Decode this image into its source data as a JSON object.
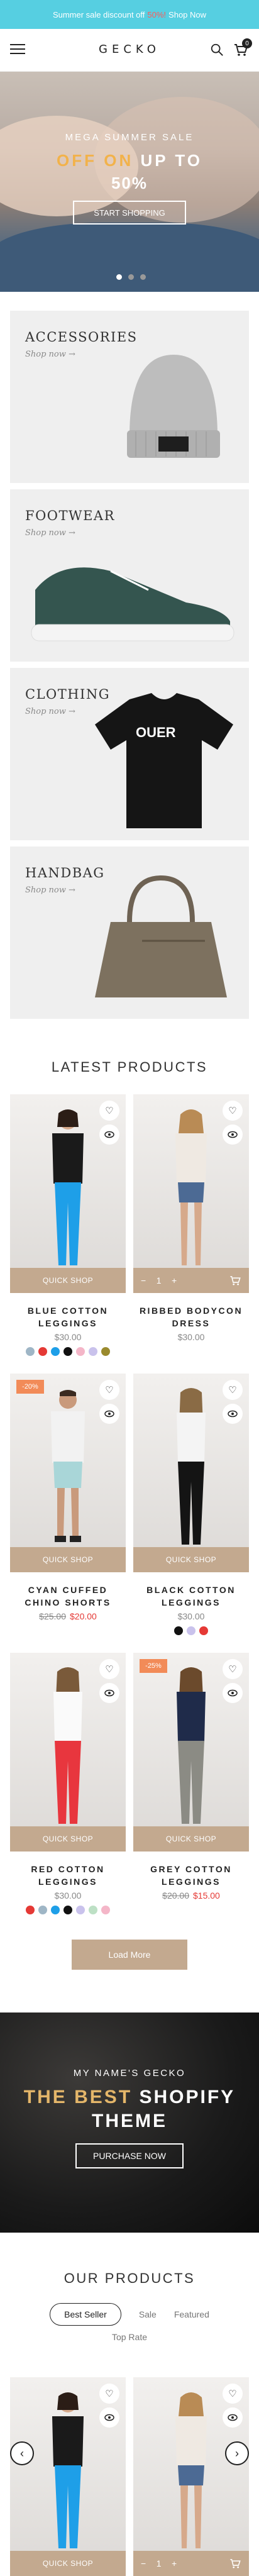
{
  "announcement": {
    "prefix": "Summer sale discount off",
    "highlight": "50%!",
    "link": "Shop Now"
  },
  "header": {
    "logo": "GECKO",
    "cart_count": "0"
  },
  "hero": {
    "subtitle": "MEGA SUMMER SALE",
    "title_prefix": "OFF ON",
    "title_suffix": "UP TO",
    "percent": "50%",
    "button": "START SHOPPING"
  },
  "categories": [
    {
      "name": "ACCESSORIES",
      "link": "Shop now →"
    },
    {
      "name": "FOOTWEAR",
      "link": "Shop now →"
    },
    {
      "name": "CLOTHING",
      "link": "Shop now →"
    },
    {
      "name": "HANDBAG",
      "link": "Shop now →"
    }
  ],
  "latest": {
    "title": "LATEST PRODUCTS",
    "products": [
      {
        "name": "BLUE COTTON LEGGINGS",
        "price": "$30.00",
        "bar": "QUICK SHOP"
      },
      {
        "name": "RIBBED BODYCON DRESS",
        "price": "$30.00",
        "qty": "1"
      },
      {
        "name": "CYAN CUFFED CHINO SHORTS",
        "old_price": "$25.00",
        "new_price": "$20.00",
        "bar": "QUICK SHOP",
        "badge": "-20%"
      },
      {
        "name": "BLACK COTTON LEGGINGS",
        "price": "$30.00",
        "bar": "QUICK SHOP"
      },
      {
        "name": "RED COTTON LEGGINGS",
        "price": "$30.00",
        "bar": "QUICK SHOP"
      },
      {
        "name": "GREY COTTON LEGGINGS",
        "old_price": "$20.00",
        "new_price": "$15.00",
        "bar": "QUICK SHOP",
        "badge": "-25%"
      }
    ],
    "load_more": "Load More"
  },
  "banner": {
    "subtitle": "MY NAME'S GECKO",
    "title_a": "THE BEST",
    "title_b": "SHOPIFY",
    "title_c": "THEME",
    "button": "PURCHASE NOW"
  },
  "our_products": {
    "title": "OUR PRODUCTS",
    "tabs": [
      "Best Seller",
      "Sale",
      "Featured",
      "Top Rate"
    ],
    "products": [
      {
        "bar": "QUICK SHOP"
      },
      {
        "qty": "1"
      }
    ]
  },
  "colors": {
    "announce": "#56cfe1",
    "accent": "#c3a98f",
    "sale": "#f28b58",
    "price_red": "#e53935"
  }
}
